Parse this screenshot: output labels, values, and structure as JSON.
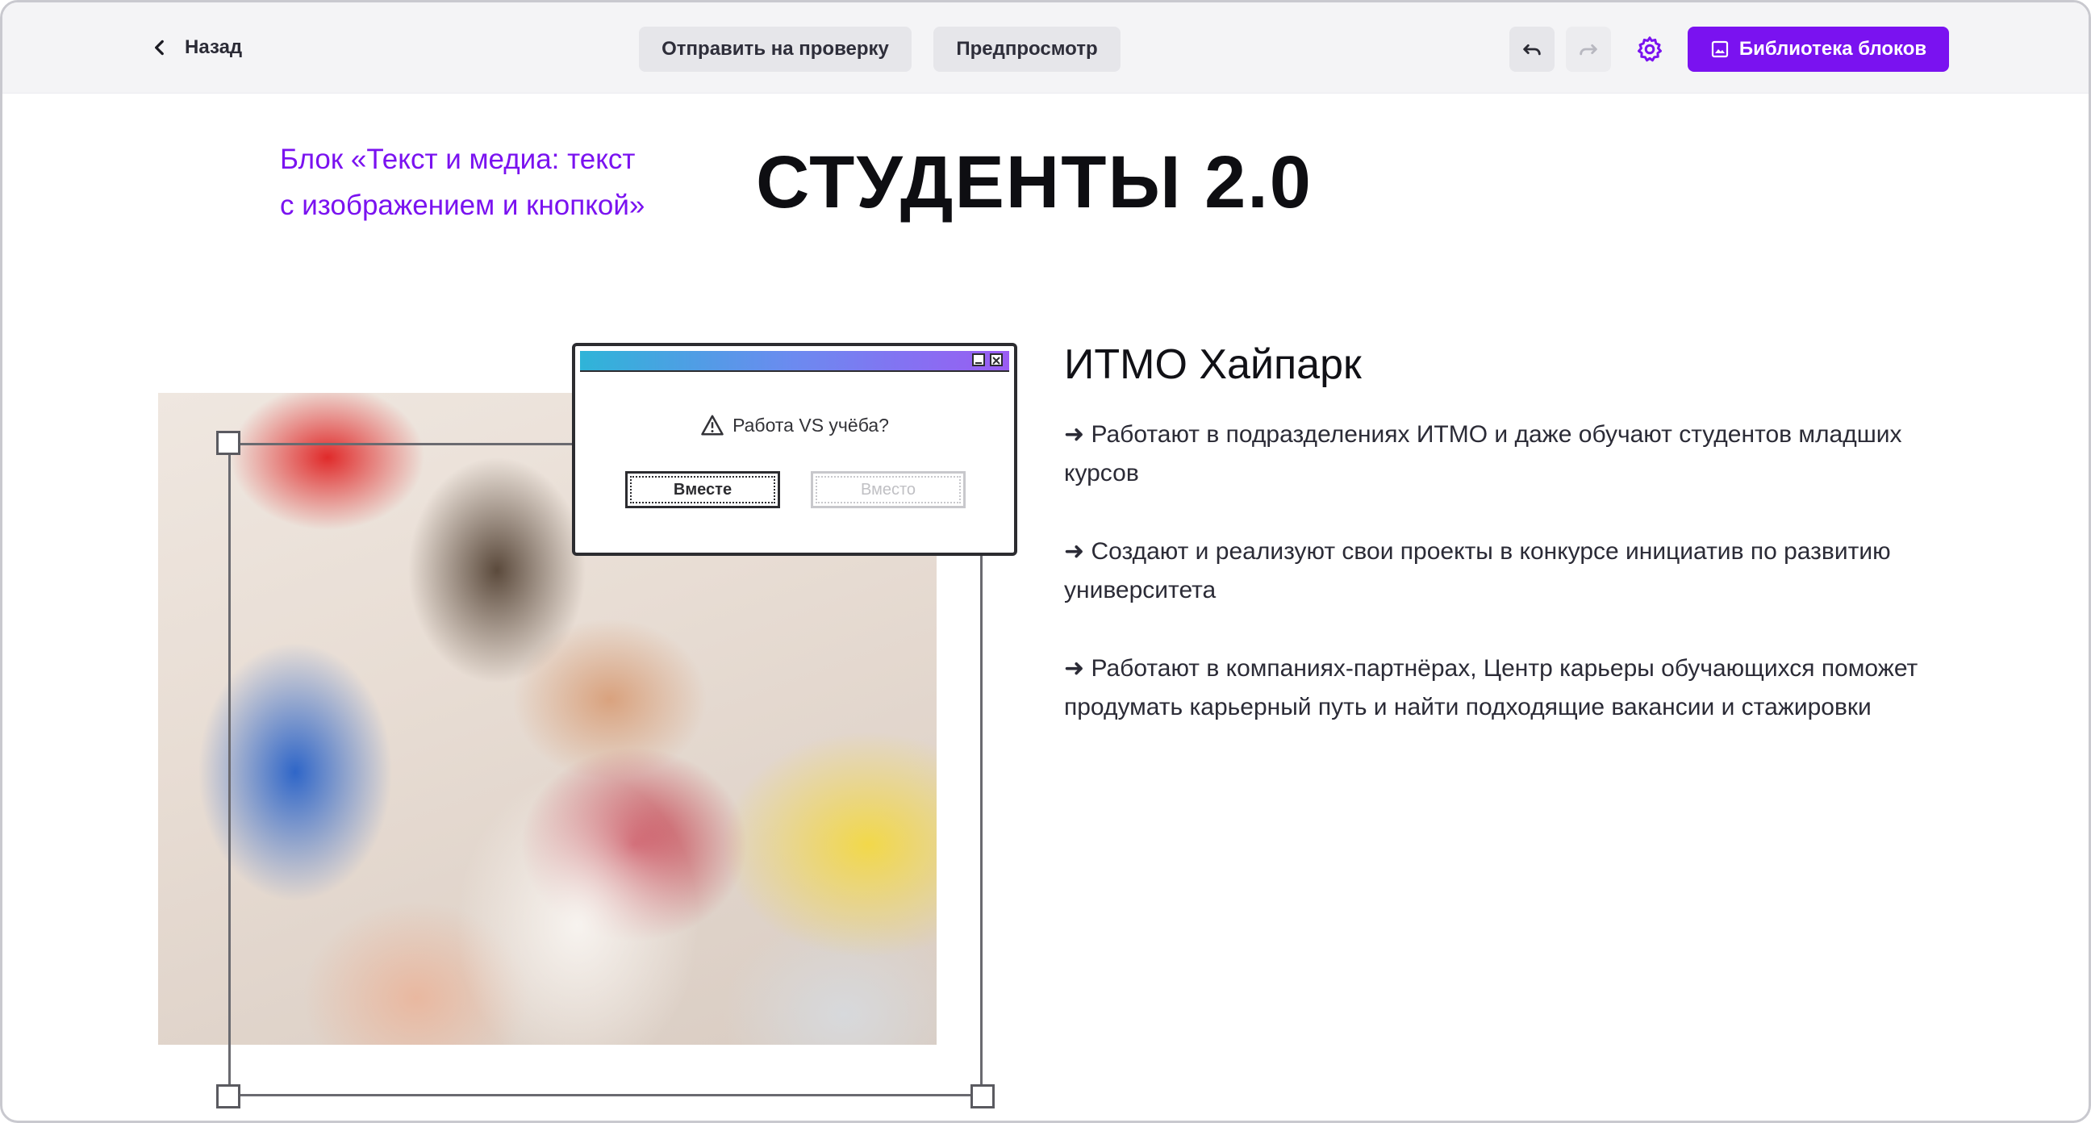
{
  "toolbar": {
    "back_label": "Назад",
    "send_review_label": "Отправить на проверку",
    "preview_label": "Предпросмотр",
    "library_label": "Библиотека блоков"
  },
  "header": {
    "block_label_line1": "Блок «Текст и медиа: текст",
    "block_label_line2": "с изображением и кнопкой»",
    "title": "СТУДЕНТЫ 2.0"
  },
  "dialog": {
    "message": "Работа VS учёба?",
    "btn_primary": "Вместе",
    "btn_disabled": "Вместо"
  },
  "content": {
    "title": "ИТМО Хайпарк",
    "bullets": [
      "➜ Работают в подразделениях ИТМО и даже обучают студентов младших курсов",
      "➜ Создают и реализуют свои проекты в конкурсе инициатив по развитию университета",
      "➜ Работают в компаниях-партнёрах, Центр карьеры обучающихся поможет продумать карьерный путь и найти подходящие вакансии и стажировки"
    ]
  },
  "colors": {
    "accent": "#7a12f0",
    "toolbar_bg": "#f4f4f6"
  }
}
